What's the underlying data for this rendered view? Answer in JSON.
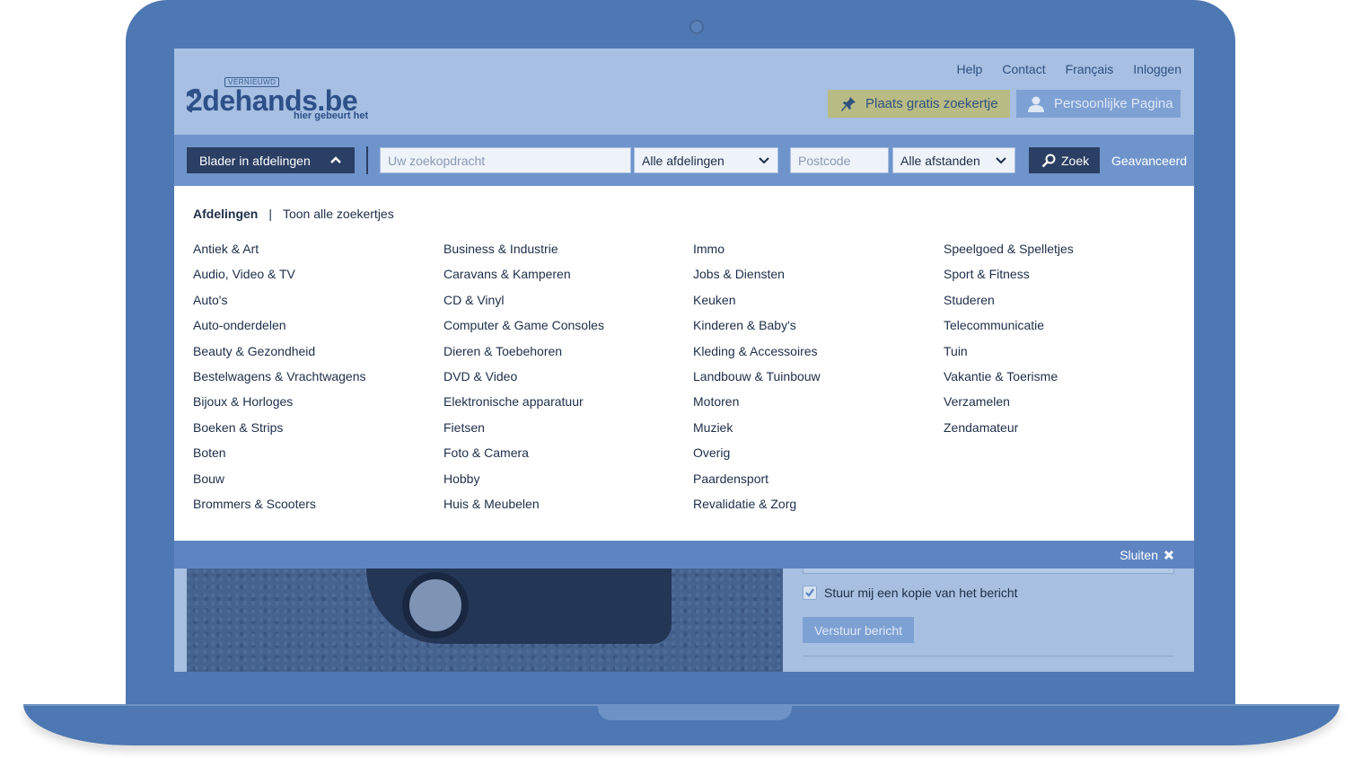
{
  "header": {
    "logo": {
      "badge": "VERNIEUWD",
      "name": "2dehands.be",
      "tagline": "hier gebeurt het"
    },
    "top_links": [
      "Help",
      "Contact",
      "Français",
      "Inloggen"
    ],
    "place_ad_button": "Plaats gratis zoekertje",
    "personal_page_button": "Persoonlijke Pagina"
  },
  "searchbar": {
    "browse_label": "Blader in afdelingen",
    "query_placeholder": "Uw zoekopdracht",
    "department_select": "Alle afdelingen",
    "postcode_placeholder": "Postcode",
    "distance_select": "Alle afstanden",
    "search_button": "Zoek",
    "advanced_link": "Geavanceerd"
  },
  "panel": {
    "tab_active": "Afdelingen",
    "tab_separator": "|",
    "tab_all": "Toon alle zoekertjes",
    "columns": [
      [
        "Antiek & Art",
        "Audio, Video & TV",
        "Auto's",
        "Auto-onderdelen",
        "Beauty & Gezondheid",
        "Bestelwagens & Vrachtwagens",
        "Bijoux & Horloges",
        "Boeken & Strips",
        "Boten",
        "Bouw",
        "Brommers & Scooters"
      ],
      [
        "Business & Industrie",
        "Caravans & Kamperen",
        "CD & Vinyl",
        "Computer & Game Consoles",
        "Dieren & Toebehoren",
        "DVD & Video",
        "Elektronische apparatuur",
        "Fietsen",
        "Foto & Camera",
        "Hobby",
        "Huis & Meubelen"
      ],
      [
        "Immo",
        "Jobs & Diensten",
        "Keuken",
        "Kinderen & Baby's",
        "Kleding & Accessoires",
        "Landbouw & Tuinbouw",
        "Motoren",
        "Muziek",
        "Overig",
        "Paardensport",
        "Revalidatie & Zorg"
      ],
      [
        "Speelgoed & Spelletjes",
        "Sport & Fitness",
        "Studeren",
        "Telecommunicatie",
        "Tuin",
        "Vakantie & Toerisme",
        "Verzamelen",
        "Zendamateur"
      ]
    ],
    "close_label": "Sluiten"
  },
  "background_page": {
    "copy_checkbox_label": "Stuur mij een kopie van het bericht",
    "copy_checked": true,
    "send_button": "Verstuur bericht"
  },
  "colors": {
    "laptop": "#4e78b3",
    "header_bg": "#a6bfe2",
    "searchbar_bg": "#6f94cb",
    "dark_button": "#2b3f64",
    "place_button": "#b9bb84"
  },
  "icons": [
    "pin-icon",
    "user-icon",
    "chevron-up-icon",
    "chevron-down-icon",
    "search-icon",
    "close-icon",
    "check-icon",
    "camera-dot-icon"
  ]
}
